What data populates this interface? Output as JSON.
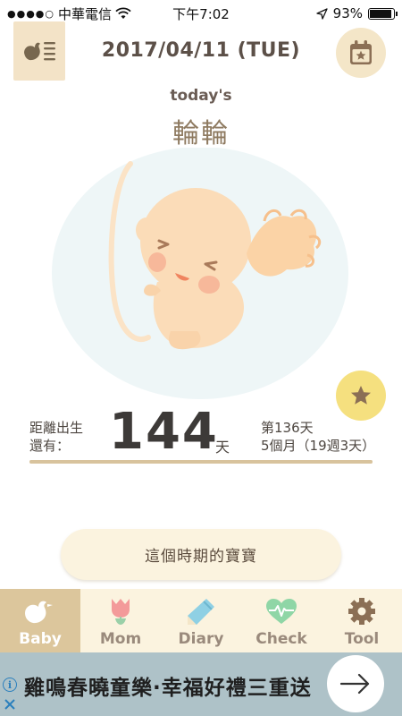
{
  "status_bar": {
    "signal_dots": "●●●●○",
    "carrier": "中華電信",
    "time": "下午7:02",
    "battery": "93%",
    "battery_level": 0.93
  },
  "header": {
    "date": "2017/04/11 (TUE)"
  },
  "today": {
    "label": "today's",
    "baby_name": "輪輪"
  },
  "countdown": {
    "label": "距離出生\n還有：",
    "value": "144",
    "unit": "天",
    "day_count": "第136天",
    "month_week": "5個月（19週3天）"
  },
  "period_button": {
    "label": "這個時期的寶寶"
  },
  "tabs": [
    {
      "label": "Baby",
      "icon": "bird-icon",
      "active": true
    },
    {
      "label": "Mom",
      "icon": "tulip-icon",
      "active": false
    },
    {
      "label": "Diary",
      "icon": "pencil-icon",
      "active": false
    },
    {
      "label": "Check",
      "icon": "heartbeat-icon",
      "active": false
    },
    {
      "label": "Tool",
      "icon": "gear-icon",
      "active": false
    }
  ],
  "ad": {
    "text": "雞鳴春曉童樂·幸福好禮三重送"
  },
  "colors": {
    "accent": "#dcc69c",
    "tab_bar_bg": "#fbf3df",
    "star_button": "#f5e07f",
    "ad_bg": "#aec2c8"
  }
}
